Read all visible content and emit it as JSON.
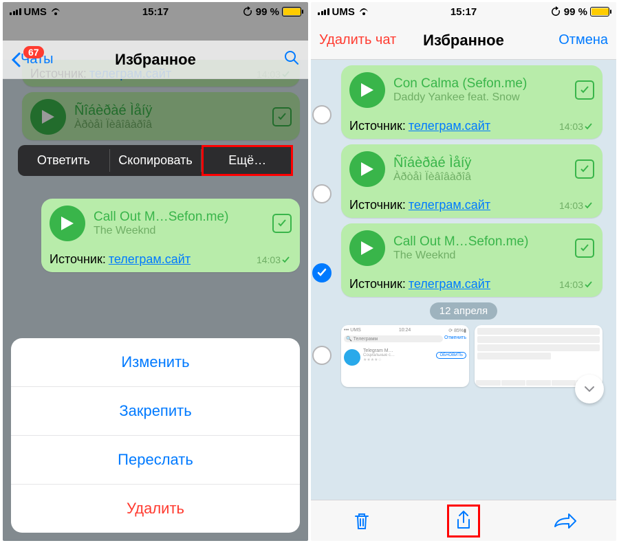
{
  "status": {
    "carrier": "UMS",
    "time": "15:17",
    "battery_pct": "99 %"
  },
  "left": {
    "nav": {
      "back": "Чаты",
      "title": "Избранное",
      "badge": "67"
    },
    "context_menu": {
      "reply": "Ответить",
      "copy": "Скопировать",
      "more": "Ещё…"
    },
    "bubble_top": {
      "source_label": "Источник:",
      "source_link": "телеграм.сайт",
      "time": "14:03",
      "garbled_title": "Ñîáèðàé Ìåíÿ",
      "garbled_sub": "Àðòåì Ïèâîâàðîâ"
    },
    "bubble_focus": {
      "title": "Call Out M…Sefon.me)",
      "artist": "The Weeknd",
      "source_label": "Источник:",
      "source_link": "телеграм.сайт",
      "time": "14:03"
    },
    "sheet": {
      "edit": "Изменить",
      "pin": "Закрепить",
      "forward": "Переслать",
      "delete": "Удалить"
    }
  },
  "right": {
    "nav": {
      "delete": "Удалить чат",
      "title": "Избранное",
      "cancel": "Отмена"
    },
    "msgs": [
      {
        "title": "Con Calma (Sefon.me)",
        "artist": "Daddy Yankee feat. Snow",
        "source_label": "Источник:",
        "source_link": "телеграм.сайт",
        "time": "14:03",
        "selected": false
      },
      {
        "title": "Ñîáèðàé Ìåíÿ",
        "artist": "Àðòåì Ïèâîâàðîâ",
        "source_label": "Источник:",
        "source_link": "телеграм.сайт",
        "time": "14:03",
        "selected": false,
        "garbled": true
      },
      {
        "title": "Call Out M…Sefon.me)",
        "artist": "The Weeknd",
        "source_label": "Источник:",
        "source_link": "телеграм.сайт",
        "time": "14:03",
        "selected": true
      }
    ],
    "date_label": "12 апреля",
    "thumb": {
      "status_time": "10:24",
      "search": "Телеграмм",
      "cancel": "Отменить",
      "app_name": "Telegram M…",
      "category": "Социальные с…",
      "button": "ОБНОВИТЬ"
    }
  }
}
